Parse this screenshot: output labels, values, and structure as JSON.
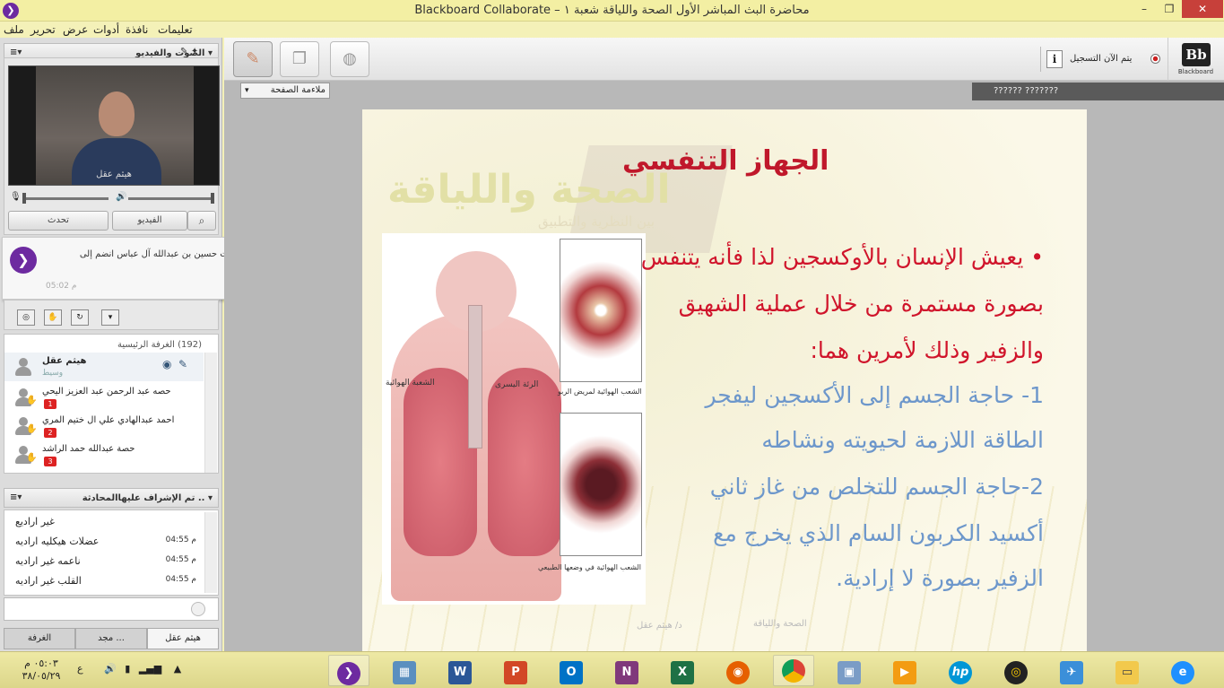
{
  "window": {
    "title": "Blackboard Collaborate – محاضرة البث المباشر الأول الصحة واللياقة شعبة ١",
    "minimize": "–",
    "restore": "❐",
    "close": "✕"
  },
  "menu": [
    "ملف",
    "تحرير",
    "عرض",
    "أدوات",
    "نافذة",
    "تعليمات"
  ],
  "av_panel": {
    "title": "الصوت والفيديو",
    "video_caption": "هيثم عقل",
    "talk_button": "تحدث",
    "video_button": "الفيديو"
  },
  "notification": {
    "message": "فاطمه بنت حسين بن عبدالله آل عباس انضم إلى session.",
    "time": "05:02 م"
  },
  "participants": {
    "room_label": "الغرفة الرئيسية",
    "count": "(192)",
    "moderator": {
      "name": "هيثم عقل",
      "role": "وسيط"
    },
    "users": [
      {
        "name": "حصه عبد الرحمن عبد العزيز اليحي",
        "hand": "1"
      },
      {
        "name": "احمد عبدالهادي علي ال ختيم المري",
        "hand": "2"
      },
      {
        "name": "حصة عبدالله حمد الراشد",
        "hand": "3"
      }
    ]
  },
  "chat": {
    "title": "تم الإشراف عليهاالمحادثة ..",
    "messages": [
      {
        "text": "غير اراديع",
        "time": ""
      },
      {
        "text": "عضلات هيكليه اراديه",
        "time": "04:55 م"
      },
      {
        "text": "ناعمه غير اراديه",
        "time": "04:55 م"
      },
      {
        "text": "القلب غير اراديه",
        "time": "04:55 م"
      }
    ],
    "tabs": [
      "هيثم عقل",
      "مجد ...",
      "الغرفة"
    ]
  },
  "toolbar": {
    "recording_label": "يتم الآن التسجيل",
    "info_icon_label": "i",
    "brand": "Bb",
    "brand_word": "Blackboard",
    "fit_option": "ملاءمة الصفحة",
    "strip_text": "?????? ???????"
  },
  "slide": {
    "watermark_title": "الصحة واللياقة",
    "watermark_subtitle": "بين النظرية والتطبيق",
    "headline": "الجهاز التنفسي",
    "lines": [
      {
        "text": "• يعيش الإنسان بالأوكسجين لذا فأنه يتنفس",
        "color": "#d0142b"
      },
      {
        "text": "بصورة مستمرة من خلال عملية الشهيق",
        "color": "#d0142b"
      },
      {
        "text": "والزفير وذلك لأمرين هما:",
        "color": "#d0142b"
      },
      {
        "text": "1- حاجة الجسم إلى الأكسجين ليفجر",
        "color": "#6d97cb"
      },
      {
        "text": "الطاقة اللازمة لحيويته ونشاطه",
        "color": "#6d97cb"
      },
      {
        "text": "2-حاجة الجسم للتخلص من غاز ثاني",
        "color": "#6d97cb"
      },
      {
        "text": "أكسيد الكربون السام الذي يخرج مع",
        "color": "#6d97cb"
      },
      {
        "text": "الزفير بصورة لا إرادية.",
        "color": "#6d97cb"
      }
    ],
    "illustration_labels": {
      "bronchus": "الشعبة الهوائية",
      "left_lung": "الرئة اليسرى",
      "asthma": "الشعب الهوائية لمريض الربو",
      "normal": "الشعب الهوائية في وضعها الطبيعي"
    },
    "footer_left": "الصحة واللياقة",
    "footer_right": "د/ هيثم عقل"
  },
  "taskbar": {
    "time": "٠٥:٠٣ م",
    "date": "٣٨/٠٥/٢٩",
    "lang": "ع",
    "apps": [
      "Collaborate",
      "Calculator",
      "W",
      "P",
      "O",
      "N",
      "X",
      "Firefox",
      "Chrome",
      "Network",
      "Media",
      "hp",
      "Disc",
      "Tool",
      "Files",
      "IE"
    ]
  },
  "colors": {
    "titlebar": "#f3efa3",
    "accent_purple": "#6d2aa0",
    "slide_red": "#d0142b",
    "slide_blue": "#6d97cb"
  }
}
